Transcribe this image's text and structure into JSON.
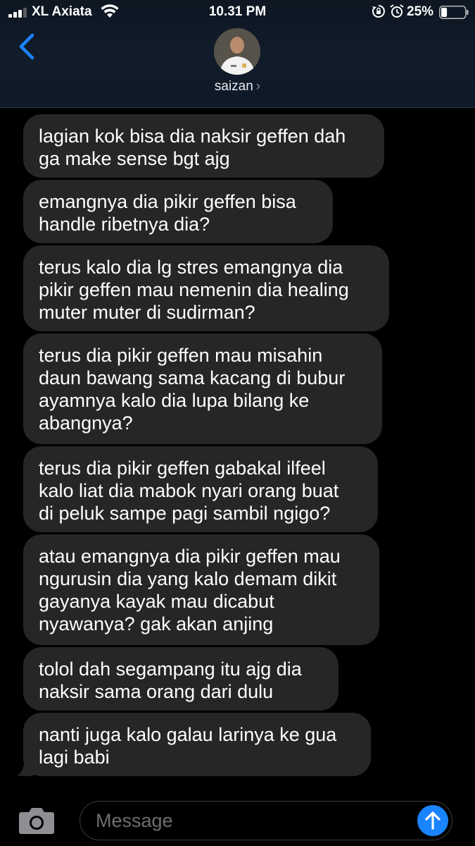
{
  "status_bar": {
    "carrier": "XL Axiata",
    "time": "10.31 PM",
    "battery_percent": "25%",
    "battery_level": 0.25
  },
  "header": {
    "contact_name": "saizan",
    "chevron": "›",
    "back_icon": "chevron-left-icon"
  },
  "messages": [
    {
      "text": "lagian kok bisa dia naksir geffen dah\nga make sense bgt ajg"
    },
    {
      "text": "emangnya dia pikir geffen bisa\nhandle ribetnya dia?"
    },
    {
      "text": "terus kalo dia lg stres emangnya dia\npikir geffen mau nemenin dia healing\nmuter muter di sudirman?"
    },
    {
      "text": "terus dia pikir geffen mau misahin\ndaun bawang sama kacang di bubur\nayamnya kalo dia lupa bilang ke\nabangnya?"
    },
    {
      "text": "terus dia pikir geffen gabakal ilfeel\nkalo liat dia mabok nyari orang buat\ndi peluk sampe pagi sambil ngigo?"
    },
    {
      "text": "atau emangnya dia pikir geffen mau\nngurusin dia yang kalo demam dikit\ngayanya kayak mau dicabut\nnyawanya? gak akan anjing"
    },
    {
      "text": "tolol dah segampang itu ajg dia\nnaksir sama orang dari dulu"
    },
    {
      "text": "nanti juga kalo galau larinya ke gua\nlagi babi"
    }
  ],
  "input": {
    "placeholder": "Message"
  },
  "colors": {
    "bubble": "#262628",
    "accent": "#1a84ff",
    "background": "#000000"
  }
}
